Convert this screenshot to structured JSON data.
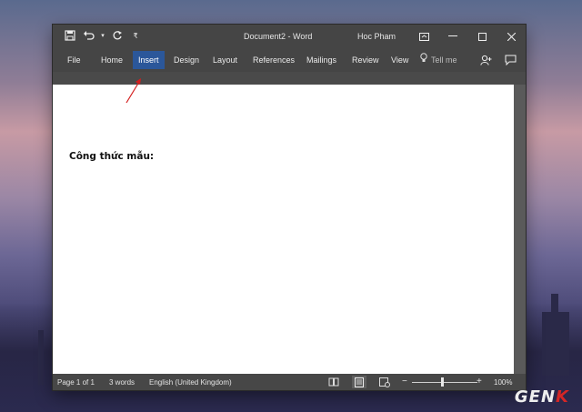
{
  "window": {
    "title": "Document2  -  Word",
    "user": "Hoc Pham"
  },
  "ribbon": {
    "tabs": [
      {
        "label": "File"
      },
      {
        "label": "Home"
      },
      {
        "label": "Insert",
        "active": true
      },
      {
        "label": "Design"
      },
      {
        "label": "Layout"
      },
      {
        "label": "References"
      },
      {
        "label": "Mailings"
      },
      {
        "label": "Review"
      },
      {
        "label": "View"
      }
    ],
    "tell_me": "Tell me"
  },
  "document": {
    "text": "Công thức mẫu:"
  },
  "status": {
    "page": "Page 1 of 1",
    "words": "3 words",
    "language": "English (United Kingdom)",
    "zoom": "100%",
    "zoom_minus": "−",
    "zoom_plus": "+"
  },
  "brand": {
    "text_main": "GEN",
    "text_accent": "K"
  },
  "colors": {
    "active_tab": "#2b579a",
    "annotation_arrow": "#d41e1e"
  }
}
